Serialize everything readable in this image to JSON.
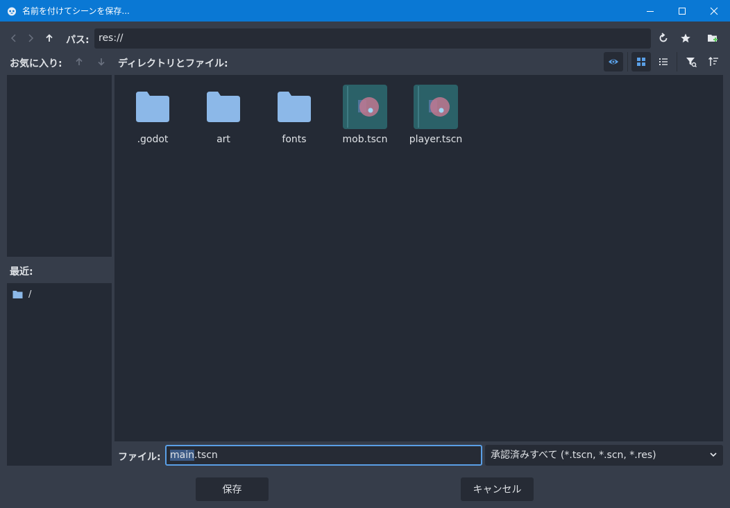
{
  "window": {
    "title": "名前を付けてシーンを保存..."
  },
  "path": {
    "label": "パス:",
    "value": "res://"
  },
  "favorites": {
    "label": "お気に入り:"
  },
  "directories": {
    "label": "ディレクトリとファイル:"
  },
  "recent": {
    "label": "最近:",
    "items": [
      {
        "name": "/"
      }
    ]
  },
  "files": [
    {
      "name": ".godot",
      "kind": "folder"
    },
    {
      "name": "art",
      "kind": "folder"
    },
    {
      "name": "fonts",
      "kind": "folder"
    },
    {
      "name": "mob.tscn",
      "kind": "scene"
    },
    {
      "name": "player.tscn",
      "kind": "scene"
    }
  ],
  "file_row": {
    "label": "ファイル:",
    "value_selected": "main",
    "value_rest": ".tscn",
    "filter": "承認済みすべて (*.tscn, *.scn, *.res)"
  },
  "buttons": {
    "save": "保存",
    "cancel": "キャンセル"
  },
  "colors": {
    "titlebar": "#0a78d4",
    "background": "#363d4a",
    "panel": "#242a35",
    "field": "#262b35",
    "accent": "#5a9fe6",
    "folder": "#8cb8e8"
  },
  "icons": [
    "godot-icon",
    "minimize-icon",
    "maximize-icon",
    "close-icon",
    "back-icon",
    "forward-icon",
    "up-icon",
    "refresh-icon",
    "star-icon",
    "new-folder-icon",
    "move-up-icon",
    "move-down-icon",
    "eye-icon",
    "grid-icon",
    "list-icon",
    "filter-icon",
    "sort-icon",
    "folder-icon",
    "scene-icon",
    "chevron-down-icon"
  ]
}
